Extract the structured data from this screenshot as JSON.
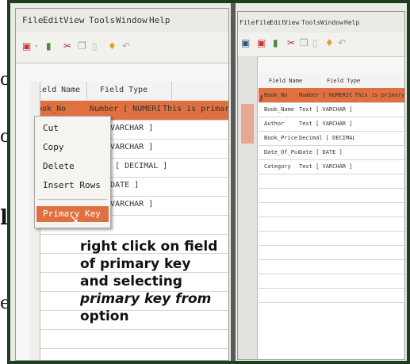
{
  "left_window": {
    "menu": [
      "File",
      "Edit",
      "View",
      "Tools",
      "Window",
      "Help"
    ],
    "columns": [
      "Field Name",
      "Field Type",
      ""
    ],
    "rows": [
      {
        "name": "Book_No",
        "type": "Number [ NUMERIC ]",
        "desc": "This is primary key"
      },
      {
        "name": "",
        "type": "[ VARCHAR ]",
        "desc": ""
      },
      {
        "name": "",
        "type": "[ VARCHAR ]",
        "desc": ""
      },
      {
        "name": "",
        "type": "mal [ DECIMAL ]",
        "desc": ""
      },
      {
        "name": "",
        "type": "[ DATE ]",
        "desc": ""
      },
      {
        "name": "",
        "type": "[ VARCHAR ]",
        "desc": ""
      }
    ],
    "context_menu": [
      "Cut",
      "Copy",
      "Delete",
      "Insert Rows",
      "Primary Key"
    ]
  },
  "right_window": {
    "menu": [
      "File",
      "Edit",
      "View",
      "Tools",
      "Window",
      "Help"
    ],
    "file_tab": "File",
    "columns": [
      "Field Name",
      "Field Type",
      ""
    ],
    "rows": [
      {
        "name": "Book_No",
        "type": "Number [ NUMERIC ]",
        "desc": "This is primary key"
      },
      {
        "name": "Book_Name",
        "type": "Text [ VARCHAR ]",
        "desc": ""
      },
      {
        "name": "Author",
        "type": "Text [ VARCHAR ]",
        "desc": ""
      },
      {
        "name": "Book_Price",
        "type": "Decimal [ DECIMAL ]",
        "desc": ""
      },
      {
        "name": "Date_Of_Pur",
        "type": "Date [ DATE ]",
        "desc": ""
      },
      {
        "name": "Category",
        "type": "Text [ VARCHAR ]",
        "desc": ""
      }
    ]
  },
  "caption": {
    "line1": "right click on field",
    "line2": "of primary key",
    "line3": "and selecting",
    "line4": "primary key from",
    "line5": "option"
  },
  "colors": {
    "selection": "#e07040",
    "frame": "#1f3d1f"
  }
}
